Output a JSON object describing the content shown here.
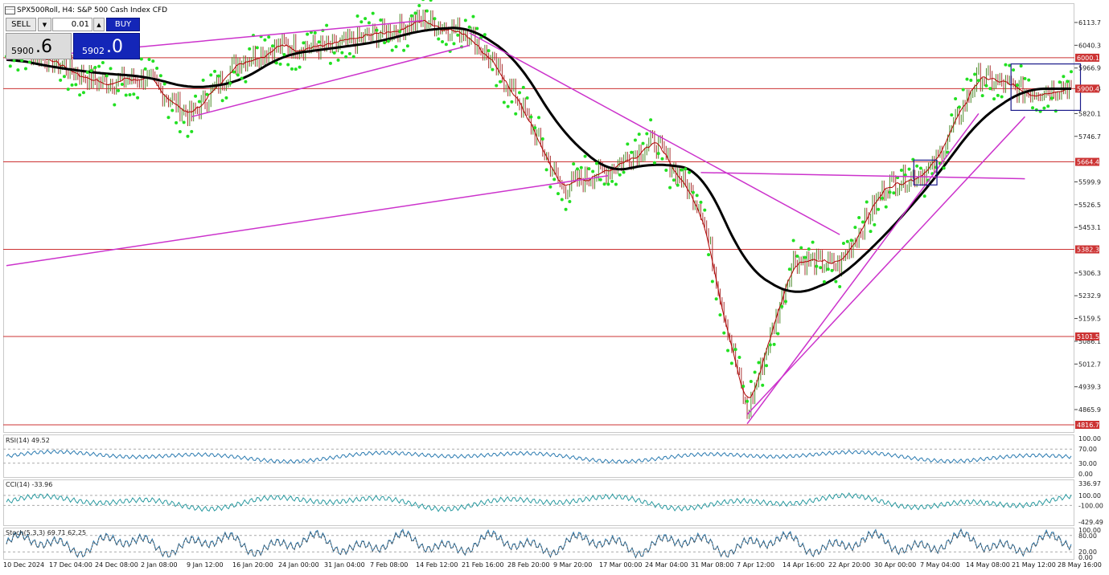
{
  "header": {
    "title": "SPX500Roll, H4:  S&P 500 Cash Index CFD"
  },
  "trade_panel": {
    "sell_label": "SELL",
    "lot_value": "0.01",
    "buy_label": "BUY",
    "bid_main": "5900",
    "bid_dot": ".",
    "bid_big": "6",
    "ask_main": "5902",
    "ask_dot": ".",
    "ask_big": "0"
  },
  "colors": {
    "sar": "#22e022",
    "ma_black": "#000000",
    "ma_red": "#b00000",
    "trendline": "#cc33cc",
    "hline": "#cc3333",
    "rect": "#1a1a8a",
    "osc": "#2a7ab0",
    "stoch_signal": "#555555"
  },
  "price_axis": {
    "ticks": [
      "6113.7",
      "6040.3",
      "5966.9",
      "5900.4",
      "5820.1",
      "5746.7",
      "5599.9",
      "5526.5",
      "5453.1",
      "5306.3",
      "5232.9",
      "5159.5",
      "5086.1",
      "5012.7",
      "4939.3",
      "4865.9"
    ],
    "hlines": [
      "6000.1",
      "5900.4",
      "5664.4",
      "5382.3",
      "5101.5",
      "4816.7"
    ]
  },
  "indicators": {
    "rsi": {
      "label": "RSI(14) 49.52",
      "ticks": [
        "100.00",
        "70.00",
        "30.00",
        "0.00"
      ]
    },
    "cci": {
      "label": "CCI(14) -33.96",
      "ticks": [
        "336.97",
        "100.00",
        "-100.00",
        "-429.49"
      ]
    },
    "stoch": {
      "label": "Stoch(5,3,3) 69.71 62.25",
      "ticks": [
        "100.00",
        "80.00",
        "20.00",
        "0.00"
      ]
    }
  },
  "x_axis": {
    "labels": [
      "10 Dec 2024",
      "17 Dec 04:00",
      "24 Dec 08:00",
      "2 Jan 08:00",
      "9 Jan 12:00",
      "16 Jan 20:00",
      "24 Jan 00:00",
      "31 Jan 04:00",
      "7 Feb 08:00",
      "14 Feb 12:00",
      "21 Feb 16:00",
      "28 Feb 20:00",
      "9 Mar 20:00",
      "17 Mar 00:00",
      "24 Mar 04:00",
      "31 Mar 08:00",
      "7 Apr 12:00",
      "14 Apr 16:00",
      "22 Apr 20:00",
      "30 Apr 00:00",
      "7 May 04:00",
      "14 May 08:00",
      "21 May 12:00",
      "28 May 16:00"
    ]
  },
  "chart_data": {
    "type": "line",
    "title": "SPX500Roll, H4:  S&P 500 Cash Index CFD",
    "xlabel": "",
    "ylabel": "",
    "ylim": [
      4800,
      6150
    ],
    "grid": false,
    "categories": [
      "10 Dec 2024",
      "17 Dec 04:00",
      "24 Dec 08:00",
      "2 Jan 08:00",
      "9 Jan 12:00",
      "16 Jan 20:00",
      "24 Jan 00:00",
      "31 Jan 04:00",
      "7 Feb 08:00",
      "14 Feb 12:00",
      "21 Feb 16:00",
      "28 Feb 20:00",
      "9 Mar 20:00",
      "17 Mar 00:00",
      "24 Mar 04:00",
      "31 Mar 08:00",
      "7 Apr 12:00",
      "14 Apr 16:00",
      "22 Apr 20:00",
      "30 Apr 00:00",
      "7 May 04:00",
      "14 May 08:00",
      "21 May 12:00",
      "28 May 16:00"
    ],
    "series": [
      {
        "values": [
          6050,
          5990,
          5920,
          5935,
          5810,
          5990,
          6040,
          6030,
          6075,
          6120,
          6080,
          5880,
          5580,
          5640,
          5730,
          5520,
          4850,
          5350,
          5330,
          5590,
          5640,
          5940,
          5890,
          5910
        ]
      },
      {
        "values": [
          6000,
          5970,
          5950,
          5940,
          5900,
          5920,
          6010,
          6030,
          6050,
          6090,
          6100,
          6000,
          5760,
          5630,
          5660,
          5640,
          5320,
          5230,
          5290,
          5430,
          5600,
          5800,
          5900,
          5900
        ]
      }
    ],
    "horizontal_levels": [
      6000.1,
      5900.4,
      5664.4,
      5382.3,
      5101.5,
      4816.7
    ],
    "rsi": {
      "last": 49.52,
      "levels": [
        70,
        30
      ],
      "range": [
        0,
        100
      ]
    },
    "cci": {
      "last": -33.96,
      "levels": [
        100,
        -100
      ],
      "range": [
        -429.49,
        336.97
      ]
    },
    "stoch": {
      "main": 69.71,
      "signal": 62.25,
      "levels": [
        80,
        20
      ],
      "range": [
        0,
        100
      ]
    }
  }
}
